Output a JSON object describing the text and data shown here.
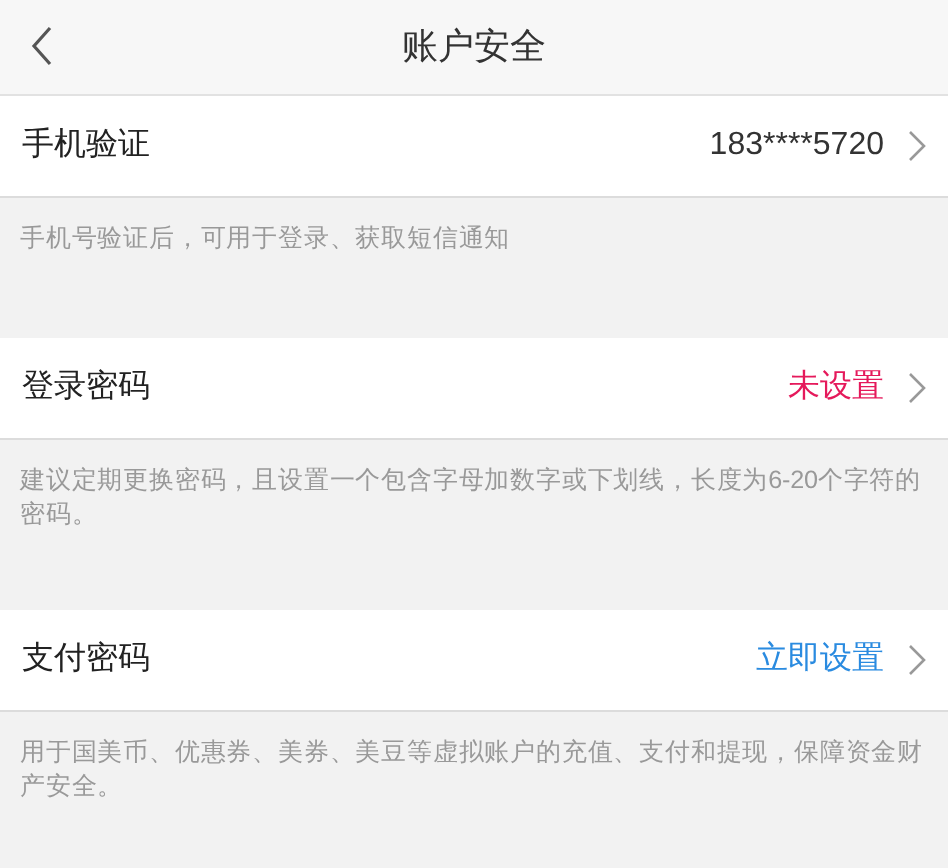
{
  "header": {
    "title": "账户安全"
  },
  "sections": [
    {
      "label": "手机验证",
      "value": "183****5720",
      "kind": "plain",
      "note": "手机号验证后，可用于登录、获取短信通知"
    },
    {
      "label": "登录密码",
      "value": "未设置",
      "kind": "warning",
      "note": "建议定期更换密码，且设置一个包含字母加数字或下划线，长度为6-20个字符的密码。"
    },
    {
      "label": "支付密码",
      "value": "立即设置",
      "kind": "action",
      "note": "用于国美币、优惠券、美券、美豆等虚拟账户的充值、支付和提现，保障资金财产安全。"
    }
  ]
}
